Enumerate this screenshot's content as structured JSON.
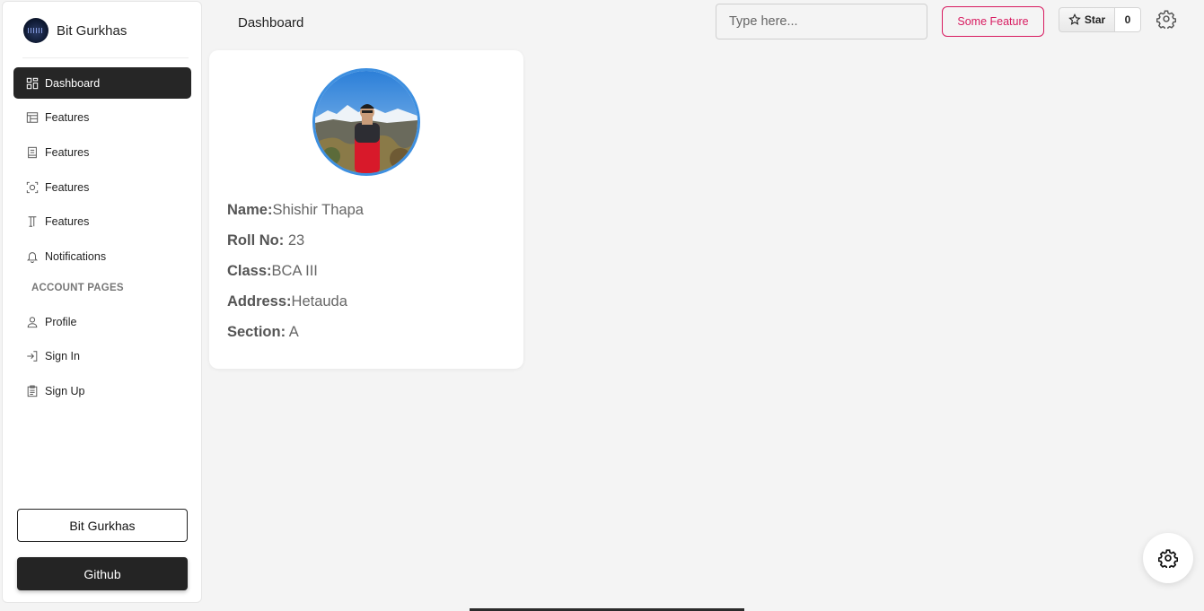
{
  "brand": {
    "name": "Bit Gurkhas"
  },
  "sidebar": {
    "items": [
      {
        "label": "Dashboard",
        "icon": "dashboard-icon",
        "active": true
      },
      {
        "label": "Features",
        "icon": "table-icon"
      },
      {
        "label": "Features",
        "icon": "document-icon"
      },
      {
        "label": "Features",
        "icon": "scan-icon"
      },
      {
        "label": "Features",
        "icon": "text-icon"
      },
      {
        "label": "Notifications",
        "icon": "bell-icon"
      }
    ],
    "section_title": "ACCOUNT PAGES",
    "account_items": [
      {
        "label": "Profile",
        "icon": "user-icon"
      },
      {
        "label": "Sign In",
        "icon": "login-icon"
      },
      {
        "label": "Sign Up",
        "icon": "clipboard-icon"
      }
    ],
    "bit_gurkhas_button": "Bit Gurkhas",
    "github_button": "Github"
  },
  "header": {
    "breadcrumb": "Dashboard",
    "search_placeholder": "Type here...",
    "feature_button": "Some Feature",
    "star_label": "Star",
    "star_count": "0"
  },
  "profile": {
    "name_key": "Name:",
    "name": "Shishir Thapa",
    "roll_key": "Roll No:",
    "roll": "23",
    "class_key": "Class:",
    "class": "BCA III",
    "address_key": "Address:",
    "address": "Hetauda",
    "section_key": "Section:",
    "section": "A"
  },
  "colors": {
    "accent": "#d81b60",
    "active_nav": "#262626",
    "avatar_ring": "#3d8fe0"
  }
}
